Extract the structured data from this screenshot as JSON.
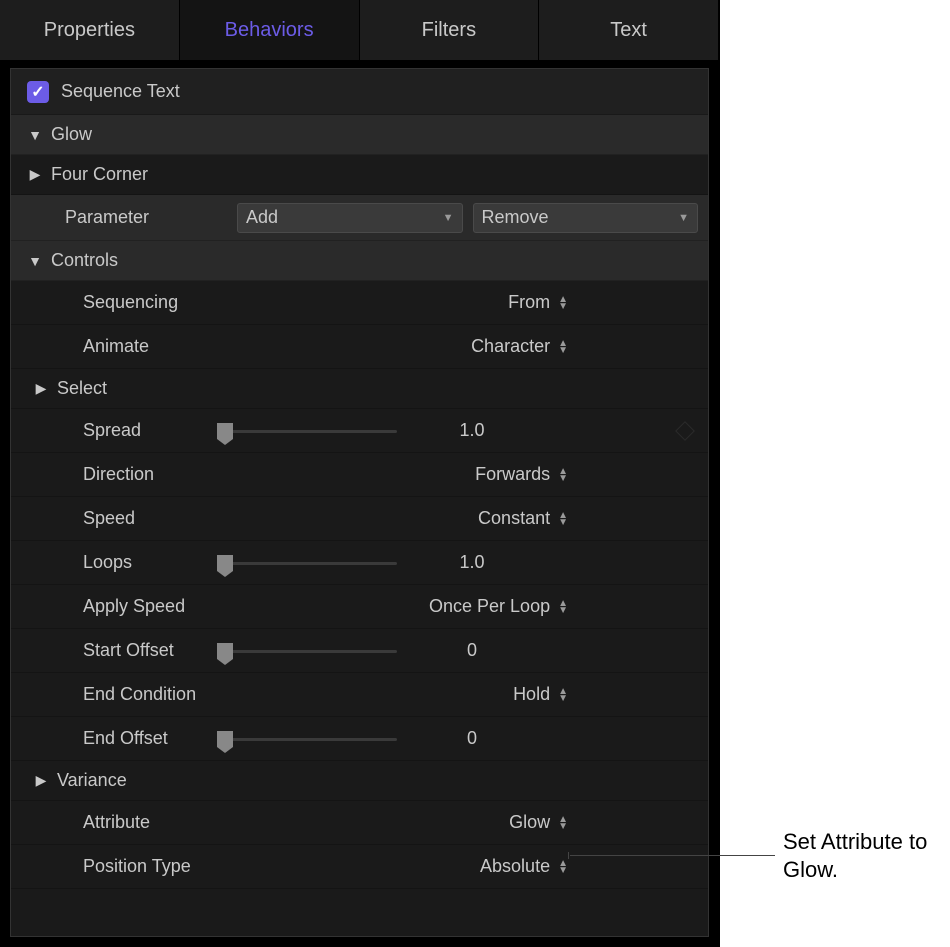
{
  "tabs": {
    "properties": "Properties",
    "behaviors": "Behaviors",
    "filters": "Filters",
    "text": "Text"
  },
  "header": {
    "title": "Sequence Text",
    "checked": true
  },
  "groups": {
    "glow": "Glow",
    "four_corner": "Four Corner",
    "controls": "Controls",
    "select": "Select",
    "variance": "Variance"
  },
  "parameter": {
    "label": "Parameter",
    "add_btn": "Add",
    "remove_btn": "Remove"
  },
  "controls": {
    "sequencing": {
      "label": "Sequencing",
      "value": "From"
    },
    "animate": {
      "label": "Animate",
      "value": "Character"
    },
    "spread": {
      "label": "Spread",
      "value": "1.0"
    },
    "direction": {
      "label": "Direction",
      "value": "Forwards"
    },
    "speed": {
      "label": "Speed",
      "value": "Constant"
    },
    "loops": {
      "label": "Loops",
      "value": "1.0"
    },
    "apply_speed": {
      "label": "Apply Speed",
      "value": "Once Per Loop"
    },
    "start_offset": {
      "label": "Start Offset",
      "value": "0"
    },
    "end_condition": {
      "label": "End Condition",
      "value": "Hold"
    },
    "end_offset": {
      "label": "End Offset",
      "value": "0"
    },
    "attribute": {
      "label": "Attribute",
      "value": "Glow"
    },
    "position_type": {
      "label": "Position Type",
      "value": "Absolute"
    }
  },
  "callout": "Set Attribute to Glow."
}
